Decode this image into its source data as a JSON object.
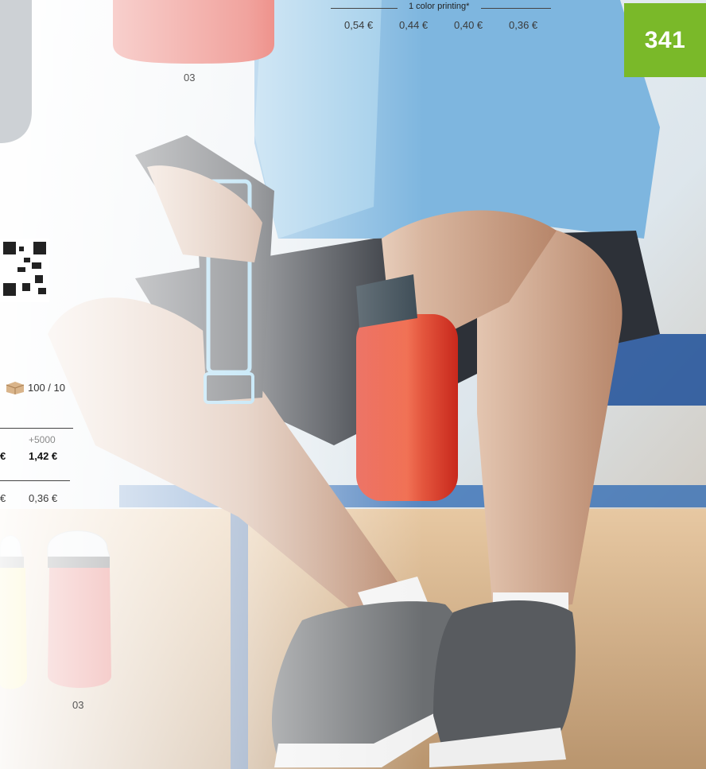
{
  "page_number": "341",
  "top_printing": {
    "label": "1 color printing*",
    "prices": [
      "0,54 €",
      "0,44 €",
      "0,40 €",
      "0,36 €"
    ]
  },
  "variant_top": {
    "code": "03"
  },
  "packaging": {
    "label": "100 / 10",
    "icon": "box-icon"
  },
  "left_table": {
    "qty_header": "+5000",
    "price_prefix": "€",
    "price": "1,42 €",
    "print_prefix": "€",
    "print_price": "0,36 €"
  },
  "variant_bottom": {
    "code": "03"
  },
  "colors": {
    "accent": "#7ab929",
    "bottle_red": "#d52a22",
    "bottle_yellow": "#f2d61a"
  }
}
